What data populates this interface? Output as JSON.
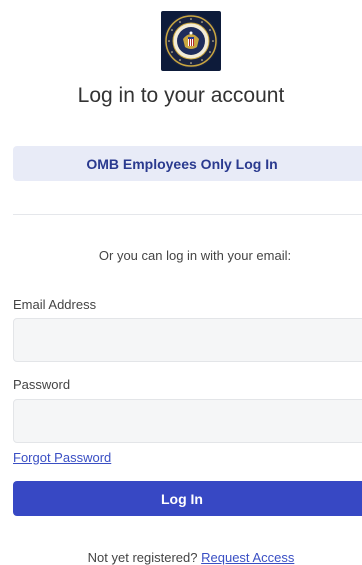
{
  "logo": {
    "icon": "presidential-seal-icon",
    "seal_text": "EXECUTIVE OFFICE OF THE PRESIDENT OF THE UNITED STATES"
  },
  "title": "Log in to your account",
  "sso_button_label": "OMB Employees Only Log In",
  "divider_text": "Or you can log in with your email:",
  "email": {
    "label": "Email Address",
    "value": "",
    "placeholder": ""
  },
  "password": {
    "label": "Password",
    "value": "",
    "placeholder": ""
  },
  "forgot_password_label": "Forgot Password",
  "login_button_label": "Log In",
  "register": {
    "prompt": "Not yet registered?",
    "link_label": "Request Access"
  },
  "colors": {
    "primary": "#3748c4",
    "sso_bg": "#e8ebf7",
    "sso_text": "#2a3a8f",
    "link": "#3a4fc4",
    "input_bg": "#f5f6f7"
  }
}
